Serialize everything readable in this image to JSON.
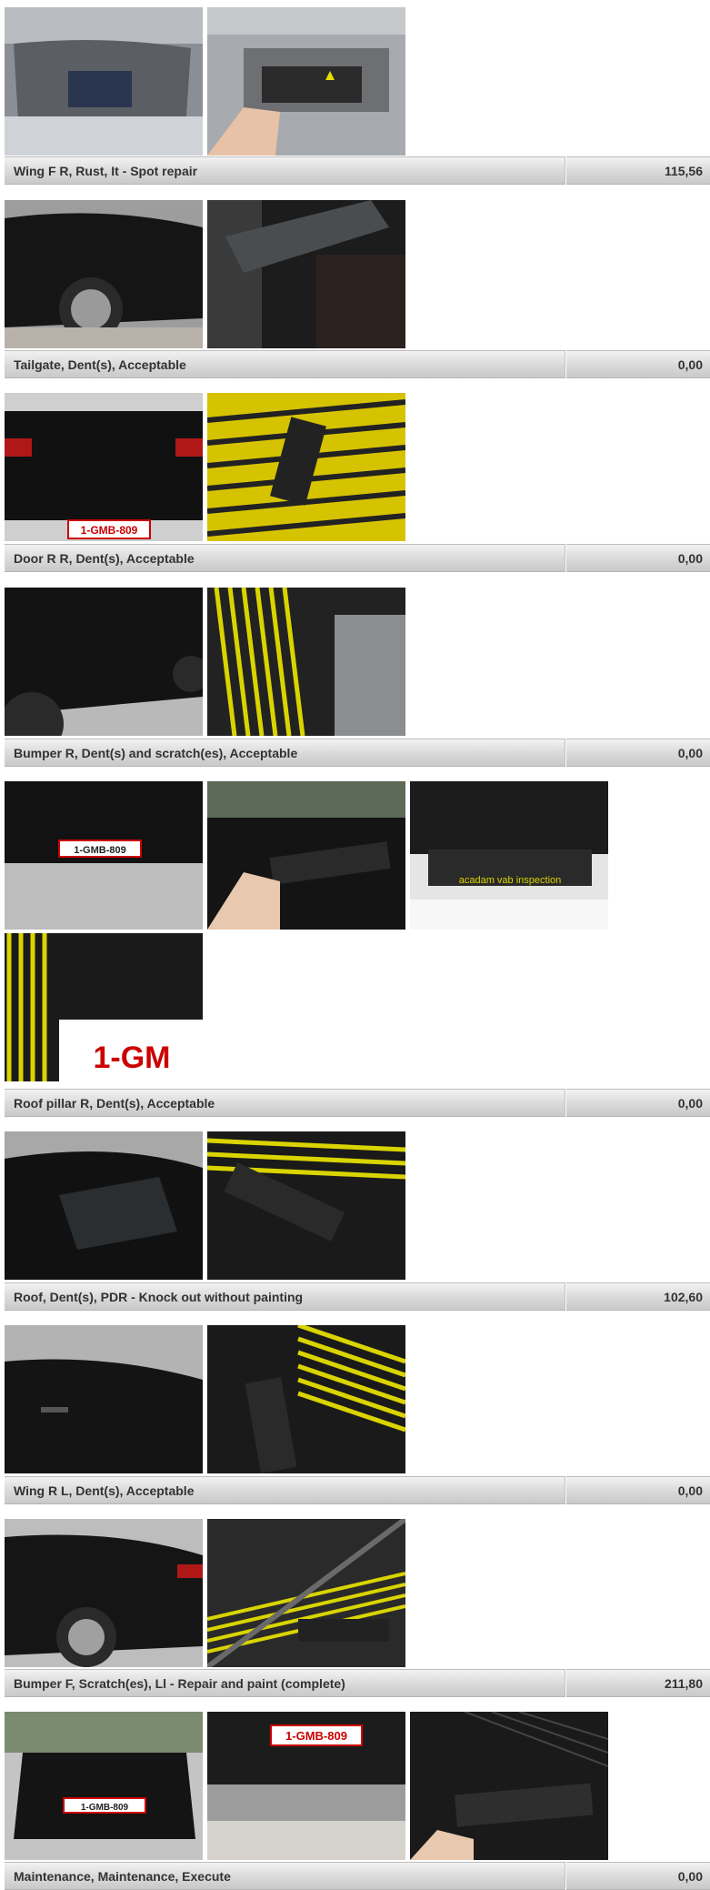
{
  "damage_items": [
    {
      "description": "Wing F R, Rust, It - Spot repair",
      "cost": "115,56"
    },
    {
      "description": "Tailgate, Dent(s), Acceptable",
      "cost": "0,00"
    },
    {
      "description": "Door R R, Dent(s), Acceptable",
      "cost": "0,00"
    },
    {
      "description": "Bumper R, Dent(s) and scratch(es), Acceptable",
      "cost": "0,00"
    },
    {
      "description": "Roof pillar R, Dent(s), Acceptable",
      "cost": "0,00"
    },
    {
      "description": "Roof, Dent(s), PDR - Knock out without painting",
      "cost": "102,60"
    },
    {
      "description": "Wing R L, Dent(s), Acceptable",
      "cost": "0,00"
    },
    {
      "description": "Bumper F, Scratch(es), Ll - Repair and paint (complete)",
      "cost": "211,80"
    },
    {
      "description": "Maintenance, Maintenance, Execute",
      "cost": "0,00"
    }
  ],
  "photo_text": {
    "plate": "1-GMB-809",
    "gauge_brand": "acadam vab inspection"
  }
}
